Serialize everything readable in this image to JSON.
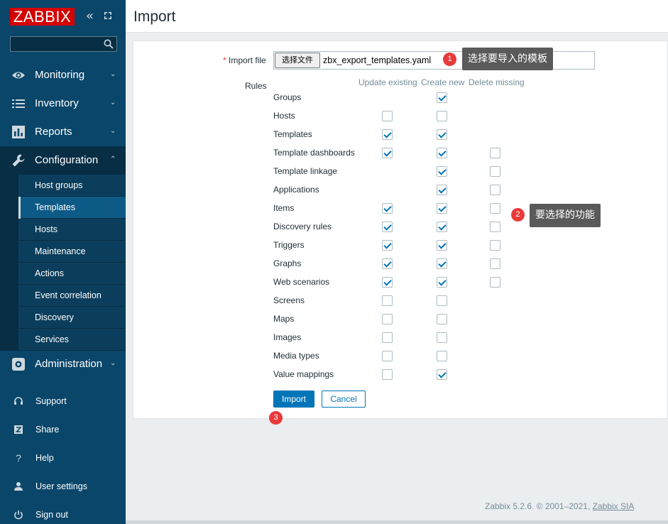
{
  "sidebar": {
    "logo": "ZABBIX",
    "search_placeholder": "",
    "menu": [
      {
        "label": "Monitoring",
        "icon": "eye-icon"
      },
      {
        "label": "Inventory",
        "icon": "list-icon"
      },
      {
        "label": "Reports",
        "icon": "bar-chart-icon"
      },
      {
        "label": "Configuration",
        "icon": "wrench-icon"
      },
      {
        "label": "Administration",
        "icon": "gear-icon"
      }
    ],
    "submenu": [
      "Host groups",
      "Templates",
      "Hosts",
      "Maintenance",
      "Actions",
      "Event correlation",
      "Discovery",
      "Services"
    ],
    "bottom": [
      "Support",
      "Share",
      "Help",
      "User settings",
      "Sign out"
    ]
  },
  "page": {
    "title": "Import"
  },
  "form": {
    "import_file_label": "Import file",
    "file_button": "选择文件",
    "file_name": "zbx_export_templates.yaml",
    "rules_label": "Rules",
    "columns": [
      "Update existing",
      "Create new",
      "Delete missing"
    ],
    "rules": [
      {
        "name": "Groups",
        "update": null,
        "create": true,
        "delete": null
      },
      {
        "name": "Hosts",
        "update": false,
        "create": false,
        "delete": null
      },
      {
        "name": "Templates",
        "update": true,
        "create": true,
        "delete": null
      },
      {
        "name": "Template dashboards",
        "update": true,
        "create": true,
        "delete": false
      },
      {
        "name": "Template linkage",
        "update": null,
        "create": true,
        "delete": false
      },
      {
        "name": "Applications",
        "update": null,
        "create": true,
        "delete": false
      },
      {
        "name": "Items",
        "update": true,
        "create": true,
        "delete": false
      },
      {
        "name": "Discovery rules",
        "update": true,
        "create": true,
        "delete": false
      },
      {
        "name": "Triggers",
        "update": true,
        "create": true,
        "delete": false
      },
      {
        "name": "Graphs",
        "update": true,
        "create": true,
        "delete": false
      },
      {
        "name": "Web scenarios",
        "update": true,
        "create": true,
        "delete": false
      },
      {
        "name": "Screens",
        "update": false,
        "create": false,
        "delete": null
      },
      {
        "name": "Maps",
        "update": false,
        "create": false,
        "delete": null
      },
      {
        "name": "Images",
        "update": false,
        "create": false,
        "delete": null
      },
      {
        "name": "Media types",
        "update": false,
        "create": false,
        "delete": null
      },
      {
        "name": "Value mappings",
        "update": false,
        "create": true,
        "delete": null
      }
    ],
    "import_button": "Import",
    "cancel_button": "Cancel"
  },
  "annotations": [
    {
      "number": "1",
      "text": "选择要导入的模板"
    },
    {
      "number": "2",
      "text": "要选择的功能"
    },
    {
      "number": "3",
      "text": ""
    }
  ],
  "footer": {
    "text": "Zabbix 5.2.6. © 2001–2021, ",
    "link": "Zabbix SIA"
  },
  "colors": {
    "sidebar": "#0a466a",
    "accent": "#0275b8",
    "logo": "#d40000",
    "badge": "#e83a3a"
  }
}
